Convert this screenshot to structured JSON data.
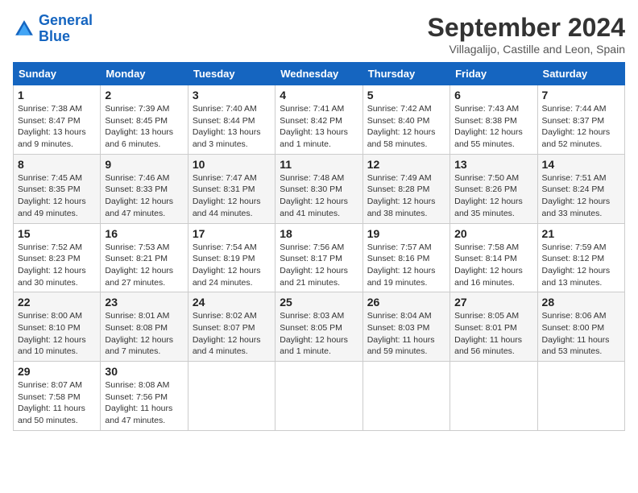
{
  "header": {
    "logo_line1": "General",
    "logo_line2": "Blue",
    "month": "September 2024",
    "location": "Villagalijo, Castille and Leon, Spain"
  },
  "weekdays": [
    "Sunday",
    "Monday",
    "Tuesday",
    "Wednesday",
    "Thursday",
    "Friday",
    "Saturday"
  ],
  "weeks": [
    [
      {
        "day": "1",
        "info": "Sunrise: 7:38 AM\nSunset: 8:47 PM\nDaylight: 13 hours\nand 9 minutes."
      },
      {
        "day": "2",
        "info": "Sunrise: 7:39 AM\nSunset: 8:45 PM\nDaylight: 13 hours\nand 6 minutes."
      },
      {
        "day": "3",
        "info": "Sunrise: 7:40 AM\nSunset: 8:44 PM\nDaylight: 13 hours\nand 3 minutes."
      },
      {
        "day": "4",
        "info": "Sunrise: 7:41 AM\nSunset: 8:42 PM\nDaylight: 13 hours\nand 1 minute."
      },
      {
        "day": "5",
        "info": "Sunrise: 7:42 AM\nSunset: 8:40 PM\nDaylight: 12 hours\nand 58 minutes."
      },
      {
        "day": "6",
        "info": "Sunrise: 7:43 AM\nSunset: 8:38 PM\nDaylight: 12 hours\nand 55 minutes."
      },
      {
        "day": "7",
        "info": "Sunrise: 7:44 AM\nSunset: 8:37 PM\nDaylight: 12 hours\nand 52 minutes."
      }
    ],
    [
      {
        "day": "8",
        "info": "Sunrise: 7:45 AM\nSunset: 8:35 PM\nDaylight: 12 hours\nand 49 minutes."
      },
      {
        "day": "9",
        "info": "Sunrise: 7:46 AM\nSunset: 8:33 PM\nDaylight: 12 hours\nand 47 minutes."
      },
      {
        "day": "10",
        "info": "Sunrise: 7:47 AM\nSunset: 8:31 PM\nDaylight: 12 hours\nand 44 minutes."
      },
      {
        "day": "11",
        "info": "Sunrise: 7:48 AM\nSunset: 8:30 PM\nDaylight: 12 hours\nand 41 minutes."
      },
      {
        "day": "12",
        "info": "Sunrise: 7:49 AM\nSunset: 8:28 PM\nDaylight: 12 hours\nand 38 minutes."
      },
      {
        "day": "13",
        "info": "Sunrise: 7:50 AM\nSunset: 8:26 PM\nDaylight: 12 hours\nand 35 minutes."
      },
      {
        "day": "14",
        "info": "Sunrise: 7:51 AM\nSunset: 8:24 PM\nDaylight: 12 hours\nand 33 minutes."
      }
    ],
    [
      {
        "day": "15",
        "info": "Sunrise: 7:52 AM\nSunset: 8:23 PM\nDaylight: 12 hours\nand 30 minutes."
      },
      {
        "day": "16",
        "info": "Sunrise: 7:53 AM\nSunset: 8:21 PM\nDaylight: 12 hours\nand 27 minutes."
      },
      {
        "day": "17",
        "info": "Sunrise: 7:54 AM\nSunset: 8:19 PM\nDaylight: 12 hours\nand 24 minutes."
      },
      {
        "day": "18",
        "info": "Sunrise: 7:56 AM\nSunset: 8:17 PM\nDaylight: 12 hours\nand 21 minutes."
      },
      {
        "day": "19",
        "info": "Sunrise: 7:57 AM\nSunset: 8:16 PM\nDaylight: 12 hours\nand 19 minutes."
      },
      {
        "day": "20",
        "info": "Sunrise: 7:58 AM\nSunset: 8:14 PM\nDaylight: 12 hours\nand 16 minutes."
      },
      {
        "day": "21",
        "info": "Sunrise: 7:59 AM\nSunset: 8:12 PM\nDaylight: 12 hours\nand 13 minutes."
      }
    ],
    [
      {
        "day": "22",
        "info": "Sunrise: 8:00 AM\nSunset: 8:10 PM\nDaylight: 12 hours\nand 10 minutes."
      },
      {
        "day": "23",
        "info": "Sunrise: 8:01 AM\nSunset: 8:08 PM\nDaylight: 12 hours\nand 7 minutes."
      },
      {
        "day": "24",
        "info": "Sunrise: 8:02 AM\nSunset: 8:07 PM\nDaylight: 12 hours\nand 4 minutes."
      },
      {
        "day": "25",
        "info": "Sunrise: 8:03 AM\nSunset: 8:05 PM\nDaylight: 12 hours\nand 1 minute."
      },
      {
        "day": "26",
        "info": "Sunrise: 8:04 AM\nSunset: 8:03 PM\nDaylight: 11 hours\nand 59 minutes."
      },
      {
        "day": "27",
        "info": "Sunrise: 8:05 AM\nSunset: 8:01 PM\nDaylight: 11 hours\nand 56 minutes."
      },
      {
        "day": "28",
        "info": "Sunrise: 8:06 AM\nSunset: 8:00 PM\nDaylight: 11 hours\nand 53 minutes."
      }
    ],
    [
      {
        "day": "29",
        "info": "Sunrise: 8:07 AM\nSunset: 7:58 PM\nDaylight: 11 hours\nand 50 minutes."
      },
      {
        "day": "30",
        "info": "Sunrise: 8:08 AM\nSunset: 7:56 PM\nDaylight: 11 hours\nand 47 minutes."
      },
      {
        "day": "",
        "info": ""
      },
      {
        "day": "",
        "info": ""
      },
      {
        "day": "",
        "info": ""
      },
      {
        "day": "",
        "info": ""
      },
      {
        "day": "",
        "info": ""
      }
    ]
  ]
}
